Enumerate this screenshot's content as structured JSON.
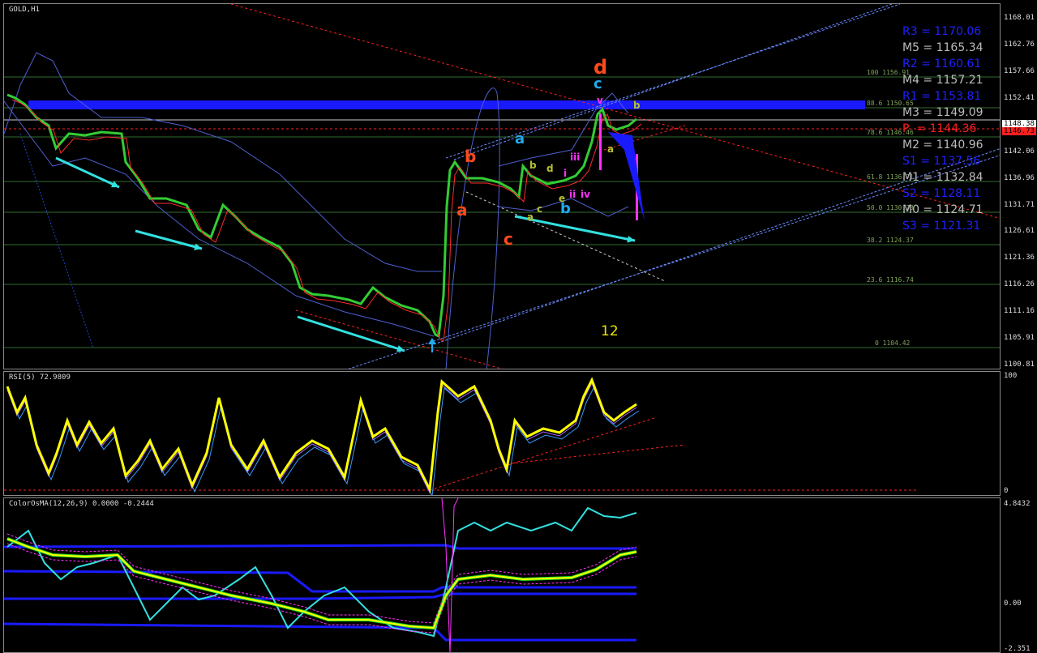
{
  "window": {
    "title": "GOLD,H1"
  },
  "colors": {
    "background": "#000000",
    "candle": "#33cc33",
    "cyan_arrow": "#33e0e0",
    "blue_zone": "#1a1aff",
    "pivot_blue": "#2020ff",
    "pivot_gray": "#bbbbbb",
    "pivot_red": "#ff2020",
    "rsi_line": "#ffff00",
    "magenta": "#ff33ff"
  },
  "price_scale": {
    "labels": [
      "1168.01",
      "1162.76",
      "1157.66",
      "1152.41",
      "1147.31",
      "1142.06",
      "1136.96",
      "1131.71",
      "1126.61",
      "1121.36",
      "1116.26",
      "1111.16",
      "1105.91",
      "1100.81"
    ],
    "bid_label": "1148.38",
    "ask_label": "1146.73"
  },
  "pivots": [
    {
      "text": "R3 = 1170.06",
      "color": "#2020ff"
    },
    {
      "text": "M5 = 1165.34",
      "color": "#bbbbbb"
    },
    {
      "text": "R2 = 1160.61",
      "color": "#2020ff"
    },
    {
      "text": "M4 = 1157.21",
      "color": "#bbbbbb"
    },
    {
      "text": "R1 = 1153.81",
      "color": "#2020ff"
    },
    {
      "text": "M3 = 1149.09",
      "color": "#bbbbbb"
    },
    {
      "text": "P  = 1144.36",
      "color": "#ff2020"
    },
    {
      "text": "M2 = 1140.96",
      "color": "#bbbbbb"
    },
    {
      "text": "S1 = 1137.56",
      "color": "#2020ff"
    },
    {
      "text": "M1 = 1132.84",
      "color": "#bbbbbb"
    },
    {
      "text": "S2 = 1128.11",
      "color": "#2020ff"
    },
    {
      "text": "M0 = 1124.71",
      "color": "#bbbbbb"
    },
    {
      "text": "S3 = 1121.31",
      "color": "#2020ff"
    }
  ],
  "fib_levels": [
    {
      "text": "100 1156.91"
    },
    {
      "text": "88.6 1150.65"
    },
    {
      "text": "78.6 1146.46"
    },
    {
      "text": "61.8 1136.71"
    },
    {
      "text": "50.0 1130.73"
    },
    {
      "text": "38.2 1124.37"
    },
    {
      "text": "23.6 1116.74"
    },
    {
      "text": "0 1104.42"
    }
  ],
  "wave_labels": [
    {
      "text": "d",
      "color": "#ff4a1a"
    },
    {
      "text": "c",
      "color": "#22aaee"
    },
    {
      "text": "b",
      "color": "#ff4a1a"
    },
    {
      "text": "a",
      "color": "#ff4a1a"
    },
    {
      "text": "c",
      "color": "#ff4a1a"
    },
    {
      "text": "a",
      "color": "#22aaee"
    },
    {
      "text": "b",
      "color": "#22aaee"
    },
    {
      "text": "b",
      "color": "#b5c032"
    },
    {
      "text": "d",
      "color": "#b5c032"
    },
    {
      "text": "c",
      "color": "#b5c032"
    },
    {
      "text": "e",
      "color": "#b5c032"
    },
    {
      "text": "a",
      "color": "#b5c032"
    },
    {
      "text": "a",
      "color": "#b5c032"
    },
    {
      "text": "b",
      "color": "#b5c032"
    },
    {
      "text": "iii",
      "color": "#ff33ff"
    },
    {
      "text": "i",
      "color": "#ff33ff"
    },
    {
      "text": "ii",
      "color": "#ff33ff"
    },
    {
      "text": "iv",
      "color": "#ff33ff"
    },
    {
      "text": "v",
      "color": "#ff33ff"
    },
    {
      "text": "12",
      "color": "#e6e600"
    }
  ],
  "rsi": {
    "title": "RSI(5) 72.9809",
    "scale_top": "100",
    "scale_bottom": "0"
  },
  "osma": {
    "title": "ColorOsMA(12,26,9) 0.0000 -0.2444",
    "scale_top": "4.8432",
    "scale_mid": "0.00",
    "scale_bottom": "-2.351"
  }
}
